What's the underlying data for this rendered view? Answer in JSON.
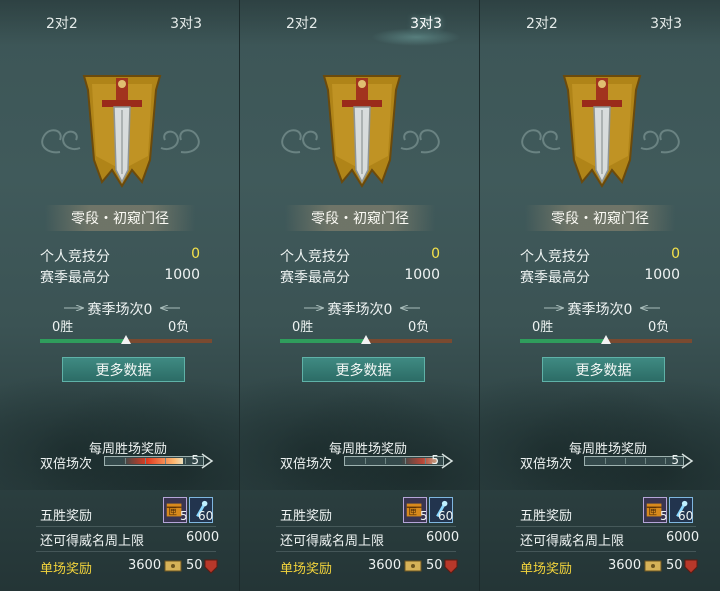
{
  "colors": {
    "accent_yellow": "#f6e24a",
    "reward_label": "#f2d33c",
    "win_bar": "#2f9d5c",
    "loss_bar": "#7a4a30",
    "button": "#2c6c66"
  },
  "panels": [
    {
      "tabs": [
        "2对2",
        "3对3"
      ],
      "active_tab": 0,
      "rank": "零段・初窥门径",
      "personal_score_label": "个人竞技分",
      "personal_score": "0",
      "season_high_label": "赛季最高分",
      "season_high": "1000",
      "season_matches": "赛季场次0",
      "wins": "0胜",
      "losses": "0负",
      "win_ratio": 0.5,
      "more_button": "更多数据",
      "weekly_title": "每周胜场奖励",
      "double_label": "双倍场次",
      "double_count": "5",
      "five_win_label": "五胜奖励",
      "item1_count": "5",
      "item2_count": "60",
      "cap_label": "还可得威名周上限",
      "cap_value": "6000",
      "single_label": "单场奖励",
      "single_value1": "3600",
      "single_value2": "50"
    },
    {
      "tabs": [
        "2对2",
        "3对3"
      ],
      "active_tab": 1,
      "rank": "零段・初窥门径",
      "personal_score_label": "个人竞技分",
      "personal_score": "0",
      "season_high_label": "赛季最高分",
      "season_high": "1000",
      "season_matches": "赛季场次0",
      "wins": "0胜",
      "losses": "0负",
      "win_ratio": 0.5,
      "more_button": "更多数据",
      "weekly_title": "每周胜场奖励",
      "double_label": "双倍场次",
      "double_count": "5",
      "five_win_label": "五胜奖励",
      "item1_count": "5",
      "item2_count": "60",
      "cap_label": "还可得威名周上限",
      "cap_value": "6000",
      "single_label": "单场奖励",
      "single_value1": "3600",
      "single_value2": "50"
    },
    {
      "tabs": [
        "2对2",
        "3对3"
      ],
      "active_tab": -1,
      "rank": "零段・初窥门径",
      "personal_score_label": "个人竞技分",
      "personal_score": "0",
      "season_high_label": "赛季最高分",
      "season_high": "1000",
      "season_matches": "赛季场次0",
      "wins": "0胜",
      "losses": "0负",
      "win_ratio": 0.5,
      "more_button": "更多数据",
      "weekly_title": "每周胜场奖励",
      "double_label": "双倍场次",
      "double_count": "5",
      "five_win_label": "五胜奖励",
      "item1_count": "5",
      "item2_count": "60",
      "cap_label": "还可得威名周上限",
      "cap_value": "6000",
      "single_label": "单场奖励",
      "single_value1": "3600",
      "single_value2": "50"
    }
  ]
}
